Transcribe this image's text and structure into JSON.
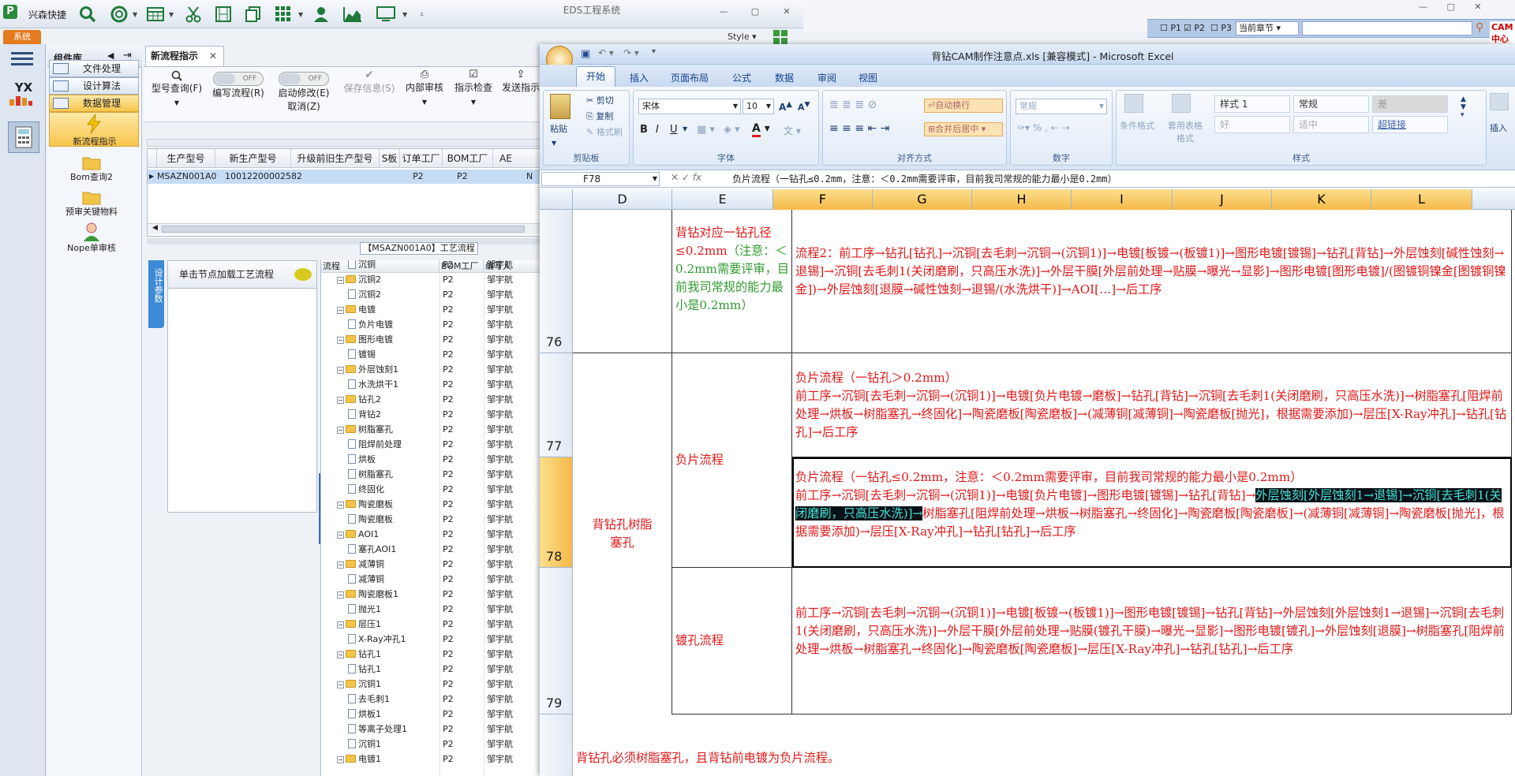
{
  "eds": {
    "app_name": "兴森快捷",
    "window_title": "EDS工程系统",
    "style_label": "Style",
    "system_tab": "系统",
    "component_title": "组件库",
    "components": [
      "文件处理",
      "设计算法",
      "数据管理"
    ],
    "side_items": [
      "新流程指示",
      "Bom查询2",
      "预审关键物料",
      "Nope单审核"
    ],
    "yx_logo": "YX",
    "workflow_tab": "新流程指示",
    "toolbar": [
      {
        "label": "型号查询(F)",
        "icon": "search-icon"
      },
      {
        "label": "编写流程(R)",
        "toggle": "OFF"
      },
      {
        "label": "启动修改(E)",
        "label2": "取消(Z)",
        "toggle": "OFF"
      },
      {
        "label": "保存信息(S)",
        "icon": "check-icon"
      },
      {
        "label": "内部审核",
        "icon": "printer-icon"
      },
      {
        "label": "指示检查",
        "icon": "check-box-icon"
      },
      {
        "label": "发送指示",
        "icon": "upload-icon"
      }
    ],
    "grid_headers": [
      "生产型号",
      "新生产型号",
      "升级前旧生产型号",
      "S板",
      "订单工厂",
      "BOM工厂",
      "AE"
    ],
    "grid_row": [
      "MSAZN001A0",
      "10012200002582",
      "",
      "",
      "P2",
      "P2",
      "N"
    ],
    "process_title": "【MSAZN001A0】工艺流程",
    "vertical_tab": "设计参数",
    "load_label": "单击节点加载工艺流程",
    "tree_headers": [
      "流程",
      "BOM工厂",
      "编写人"
    ],
    "tree_rows": [
      {
        "label": "沉铜",
        "level": 2,
        "factory": "P2",
        "author": "邹宇航"
      },
      {
        "label": "沉铜2",
        "level": 1,
        "factory": "P2",
        "author": "邹宇航"
      },
      {
        "label": "沉铜2",
        "level": 2,
        "factory": "P2",
        "author": "邹宇航"
      },
      {
        "label": "电镀",
        "level": 1,
        "factory": "P2",
        "author": "邹宇航"
      },
      {
        "label": "负片电镀",
        "level": 2,
        "factory": "P2",
        "author": "邹宇航"
      },
      {
        "label": "图形电镀",
        "level": 1,
        "factory": "P2",
        "author": "邹宇航"
      },
      {
        "label": "镀锡",
        "level": 2,
        "factory": "P2",
        "author": "邹宇航"
      },
      {
        "label": "外层蚀刻1",
        "level": 1,
        "factory": "P2",
        "author": "邹宇航"
      },
      {
        "label": "水洗烘干1",
        "level": 2,
        "factory": "P2",
        "author": "邹宇航"
      },
      {
        "label": "钻孔2",
        "level": 1,
        "factory": "P2",
        "author": "邹宇航"
      },
      {
        "label": "背钻2",
        "level": 2,
        "factory": "P2",
        "author": "邹宇航"
      },
      {
        "label": "树脂塞孔",
        "level": 1,
        "factory": "P2",
        "author": "邹宇航"
      },
      {
        "label": "阻焊前处理",
        "level": 2,
        "factory": "P2",
        "author": "邹宇航"
      },
      {
        "label": "烘板",
        "level": 2,
        "factory": "P2",
        "author": "邹宇航"
      },
      {
        "label": "树脂塞孔",
        "level": 2,
        "factory": "P2",
        "author": "邹宇航"
      },
      {
        "label": "终固化",
        "level": 2,
        "factory": "P2",
        "author": "邹宇航"
      },
      {
        "label": "陶瓷磨板",
        "level": 1,
        "factory": "P2",
        "author": "邹宇航"
      },
      {
        "label": "陶瓷磨板",
        "level": 2,
        "factory": "P2",
        "author": "邹宇航"
      },
      {
        "label": "AOI1",
        "level": 1,
        "factory": "P2",
        "author": "邹宇航"
      },
      {
        "label": "塞孔AOI1",
        "level": 2,
        "factory": "P2",
        "author": "邹宇航"
      },
      {
        "label": "减薄铜",
        "level": 1,
        "factory": "P2",
        "author": "邹宇航"
      },
      {
        "label": "减薄铜",
        "level": 2,
        "factory": "P2",
        "author": "邹宇航"
      },
      {
        "label": "陶瓷磨板1",
        "level": 1,
        "factory": "P2",
        "author": "邹宇航"
      },
      {
        "label": "抛光1",
        "level": 2,
        "factory": "P2",
        "author": "邹宇航"
      },
      {
        "label": "层压1",
        "level": 1,
        "factory": "P2",
        "author": "邹宇航"
      },
      {
        "label": "X-Ray冲孔1",
        "level": 2,
        "factory": "P2",
        "author": "邹宇航"
      },
      {
        "label": "钻孔1",
        "level": 1,
        "factory": "P2",
        "author": "邹宇航"
      },
      {
        "label": "钻孔1",
        "level": 2,
        "factory": "P2",
        "author": "邹宇航"
      },
      {
        "label": "沉铜1",
        "level": 1,
        "factory": "P2",
        "author": "邹宇航"
      },
      {
        "label": "去毛刺1",
        "level": 2,
        "factory": "P2",
        "author": "邹宇航"
      },
      {
        "label": "烘板1",
        "level": 2,
        "factory": "P2",
        "author": "邹宇航"
      },
      {
        "label": "等离子处理1",
        "level": 2,
        "factory": "P2",
        "author": "邹宇航"
      },
      {
        "label": "沉铜1",
        "level": 2,
        "factory": "P2",
        "author": "邹宇航"
      },
      {
        "label": "电镀1",
        "level": 1,
        "factory": "P2",
        "author": "邹宇航"
      }
    ]
  },
  "right_strip": {
    "checks": [
      "P1",
      "P2",
      "P3"
    ],
    "combo": "当前章节",
    "brand": "CAM中心"
  },
  "excel": {
    "title": "背钻CAM制作注意点.xls  [兼容模式] - Microsoft Excel",
    "tabs": [
      "开始",
      "插入",
      "页面布局",
      "公式",
      "数据",
      "审阅",
      "视图"
    ],
    "clipboard": {
      "paste": "粘贴",
      "cut": "剪切",
      "copy": "复制",
      "format": "格式刷",
      "group": "剪贴板"
    },
    "font": {
      "name": "宋体",
      "size": "10",
      "group": "字体"
    },
    "align": {
      "wrap": "自动换行",
      "merge": "合并后居中",
      "group": "对齐方式"
    },
    "number": {
      "format": "常规",
      "group": "数字"
    },
    "styles": {
      "cond": "条件格式",
      "table": "套用表格格式",
      "group": "样式",
      "cells": [
        "样式 1",
        "常规",
        "差",
        "好",
        "适中",
        "超链接"
      ]
    },
    "insert": "插入",
    "name_box": "F78",
    "formula": "负片流程（一钻孔≤0.2mm，注意：＜0.2mm需要评审，目前我司常规的能力最小是0.2mm）",
    "columns": [
      "D",
      "E",
      "F",
      "G",
      "H",
      "I",
      "J",
      "K",
      "L"
    ],
    "rows": [
      "76",
      "77",
      "78",
      "79"
    ],
    "d_merged": "背钻孔树脂塞孔",
    "e76_red": "背钻对应一钻孔径≤0.2mm",
    "e76_green": "（注意：＜0.2mm需要评审，目前我司常规的能力最小是0.2mm）",
    "f76": "流程2：前工序→钻孔[钻孔]→沉铜[去毛刺→沉铜→(沉铜1)]→电镀[板镀→(板镀1)]→图形电镀[镀锡]→钻孔[背钻]→外层蚀刻[碱性蚀刻→退锡]→沉铜[去毛刺1(关闭磨刷，只高压水洗)]→外层干膜[外层前处理→贴膜→曝光→显影]→图形电镀[图形电镀]/(图镀铜镍金[图镀铜镍金])→外层蚀刻[退膜→碱性蚀刻→退锡/(水洗烘干)]→AOI[…]→后工序",
    "e77_78": "负片流程",
    "f77": "负片流程（一钻孔＞0.2mm）\n前工序→沉铜[去毛刺→沉铜→(沉铜1)]→电镀[负片电镀→磨板]→钻孔[背钻]→沉铜[去毛刺1(关闭磨刷，只高压水洗)]→树脂塞孔[阻焊前处理→烘板→树脂塞孔→终固化]→陶瓷磨板[陶瓷磨板]→(减薄铜[减薄铜]→陶瓷磨板[抛光]，根据需要添加)→层压[X-Ray冲孔]→钻孔[钻孔]→后工序",
    "f78_line1": "负片流程（一钻孔≤0.2mm，注意：＜0.2mm需要评审，目前我司常规的能力最小是0.2mm）",
    "f78_a": "前工序→沉铜[去毛刺→沉铜→(沉铜1)]→电镀[负片电镀]→图形电镀[镀锡]→钻孔[背钻]→",
    "f78_hl": "外层蚀刻[外层蚀刻1→退锡]→沉铜[去毛刺1(关闭磨刷，只高压水洗)]→",
    "f78_b": "树脂塞孔[阻焊前处理→烘板→树脂塞孔→终固化]→陶瓷磨板[陶瓷磨板]→(减薄铜[减薄铜]→陶瓷磨板[抛光]，根据需要添加)→层压[X-Ray冲孔]→钻孔[钻孔]→后工序",
    "e79": "镀孔流程",
    "f79": "前工序→沉铜[去毛刺→沉铜→(沉铜1)]→电镀[板镀→(板镀1)]→图形电镀[镀锡]→钻孔[背钻]→外层蚀刻[外层蚀刻1→退锡]→沉铜[去毛刺1(关闭磨刷，只高压水洗)]→外层干膜[外层前处理→贴膜(镀孔干膜)→曝光→显影]→图形电镀[镀孔]→外层蚀刻[退膜]→树脂塞孔[阻焊前处理→烘板→树脂塞孔→终固化]→陶瓷磨板[陶瓷磨板]→层压[X-Ray冲孔]→钻孔[钻孔]→后工序",
    "note": "背钻孔必须树脂塞孔，且背钻前电镀为负片流程。"
  }
}
